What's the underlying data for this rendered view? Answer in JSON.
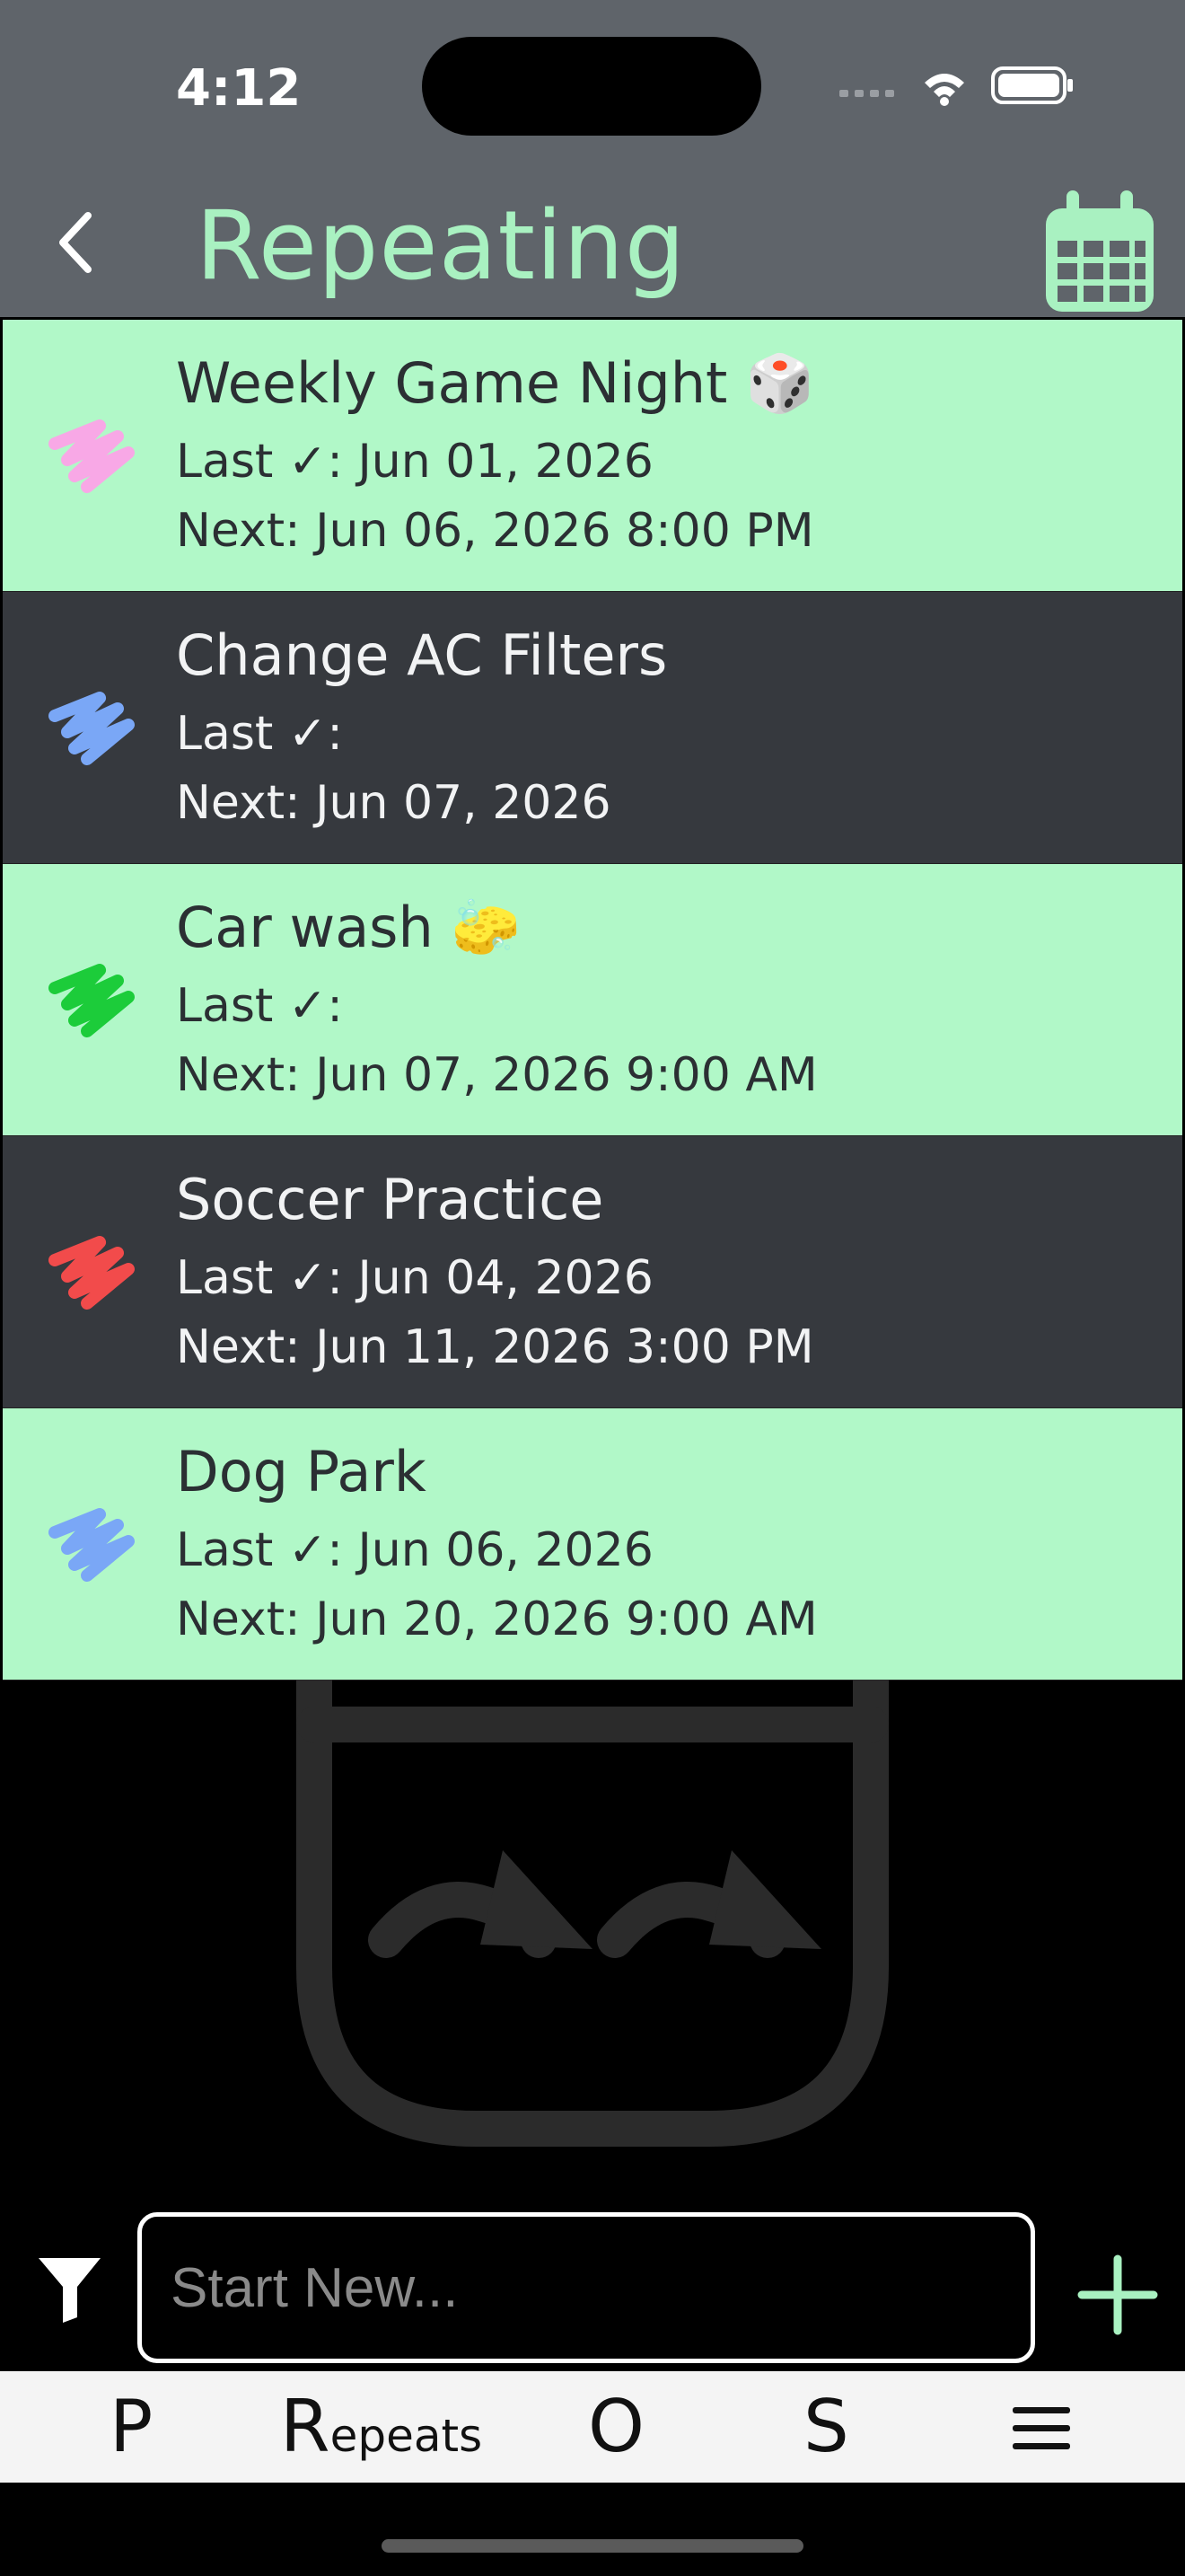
{
  "status": {
    "time": "4:12"
  },
  "header": {
    "title": "Repeating"
  },
  "items": [
    {
      "title": "Weekly Game Night 🎲",
      "last": "Last ✓: Jun 01, 2026",
      "next": "Next: Jun 06, 2026 8:00 PM",
      "color": "#f8a8e6",
      "theme": "light"
    },
    {
      "title": "Change AC Filters",
      "last": "Last ✓:",
      "next": "Next: Jun 07, 2026",
      "color": "#7aa7f6",
      "theme": "dark"
    },
    {
      "title": "Car wash 🧽",
      "last": "Last ✓:",
      "next": "Next: Jun 07, 2026 9:00 AM",
      "color": "#1ccc3a",
      "theme": "light"
    },
    {
      "title": "Soccer Practice",
      "last": "Last ✓: Jun 04, 2026",
      "next": "Next: Jun 11, 2026 3:00 PM",
      "color": "#f24b4b",
      "theme": "dark"
    },
    {
      "title": "Dog Park",
      "last": "Last ✓: Jun 06, 2026",
      "next": "Next: Jun 20, 2026 9:00 AM",
      "color": "#7aa7f6",
      "theme": "light"
    }
  ],
  "input": {
    "placeholder": "Start New..."
  },
  "tabs": {
    "p": "P",
    "r_big": "R",
    "r_small": "epeats",
    "o": "O",
    "s": "S"
  },
  "colors": {
    "accent": "#a9f1c1",
    "row_light": "#b1f8c8",
    "row_dark": "#36393e",
    "header_bg": "#5f646a"
  }
}
